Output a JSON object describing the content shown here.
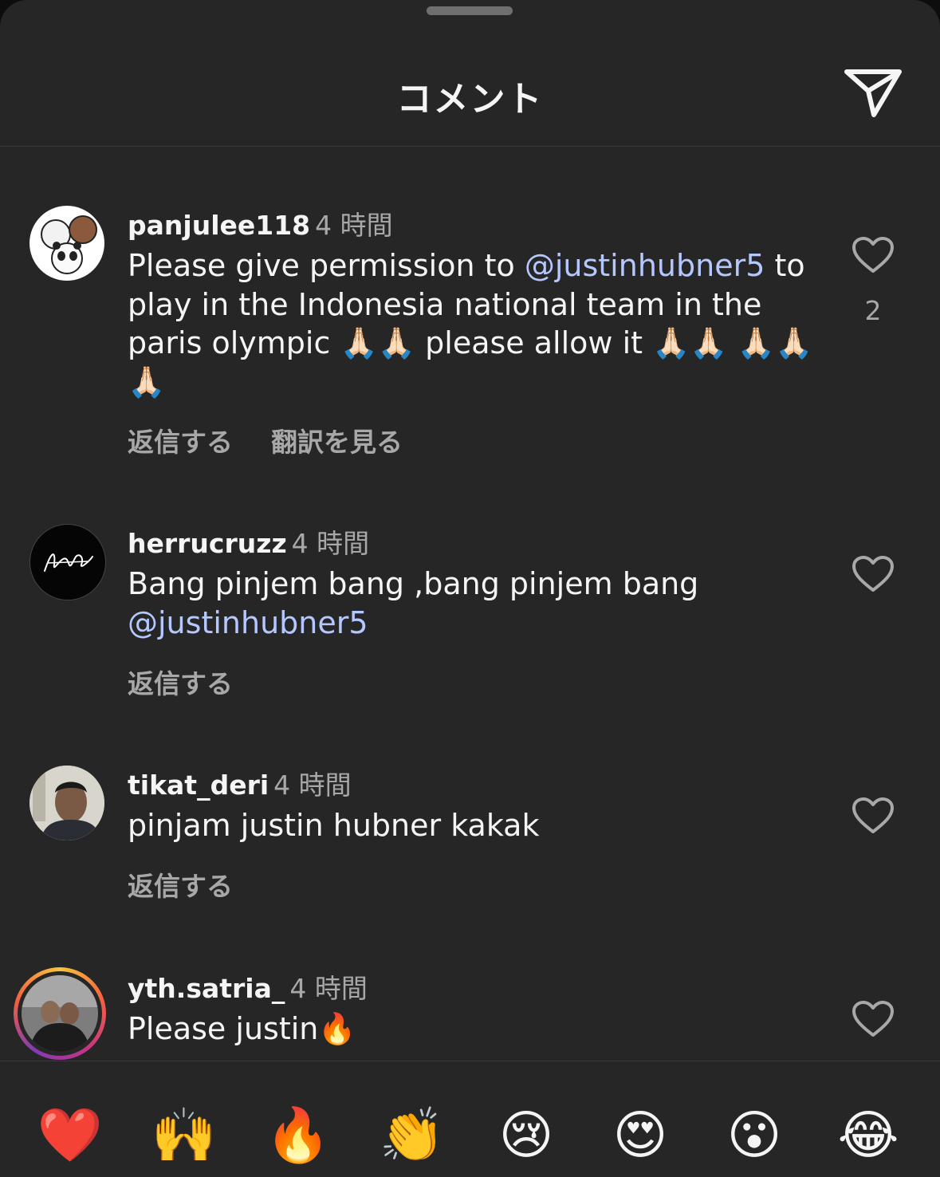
{
  "header": {
    "title": "コメント",
    "share_icon": "paper-plane-icon"
  },
  "comments": [
    {
      "username": "panjulee118",
      "time": "4 時間",
      "text_parts": [
        "Please give permission to ",
        "@justinhubner5",
        " to play in the Indonesia national team in the paris olympic ",
        "🙏🏻🙏🏻",
        " please allow it ",
        "🙏🏻🙏🏻",
        " ",
        "🙏🏻🙏🏻🙏🏻"
      ],
      "reply": "返信する",
      "translate": "翻訳を見る",
      "likes": "2"
    },
    {
      "username": "herrucruzz",
      "time": "4 時間",
      "text_parts": [
        "Bang pinjem bang ,bang pinjem bang ",
        "@justinhubner5"
      ],
      "reply": "返信する"
    },
    {
      "username": "tikat_deri",
      "time": "4 時間",
      "text": "pinjam justin hubner kakak",
      "reply": "返信する"
    },
    {
      "username": "yth.satria_",
      "time": "4 時間",
      "text": "Please justin🔥"
    }
  ],
  "reactions": [
    "❤️",
    "🙌",
    "🔥",
    "👏",
    "😢",
    "😍",
    "😮",
    "😂"
  ],
  "colors": {
    "background": "#262626",
    "text": "#f5f5f5",
    "secondary": "#a8a8a8",
    "mention": "#b4c7ff"
  }
}
